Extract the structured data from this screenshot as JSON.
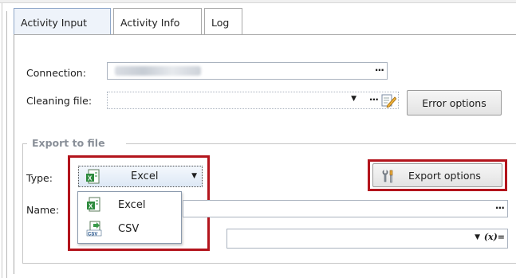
{
  "tabs": [
    {
      "label": "Activity Input",
      "active": true
    },
    {
      "label": "Activity Info",
      "active": false
    },
    {
      "label": "Log",
      "active": false
    }
  ],
  "connection": {
    "label": "Connection:",
    "ellipsis": "···"
  },
  "cleaning": {
    "label": "Cleaning file:",
    "arrow": "▼",
    "ellipsis": "···",
    "button": "Error options"
  },
  "export": {
    "group_title": "Export to file",
    "type_label": "Type:",
    "type_value": "Excel",
    "type_arrow": "▼",
    "options_button": "Export options",
    "name_label": "Name:",
    "name_ellipsis": "···",
    "expr_arrow": "▼",
    "expr_label": "(x)=",
    "dropdown_options": [
      "Excel",
      "CSV"
    ]
  },
  "colors": {
    "highlight": "#b3141c",
    "excel_green": "#2e8b3e",
    "tab_active": "#eef3fa"
  },
  "icons": {
    "excel": "excel-file-icon",
    "csv": "csv-file-icon",
    "tools": "tools-icon",
    "edit": "edit-pencil-icon"
  }
}
